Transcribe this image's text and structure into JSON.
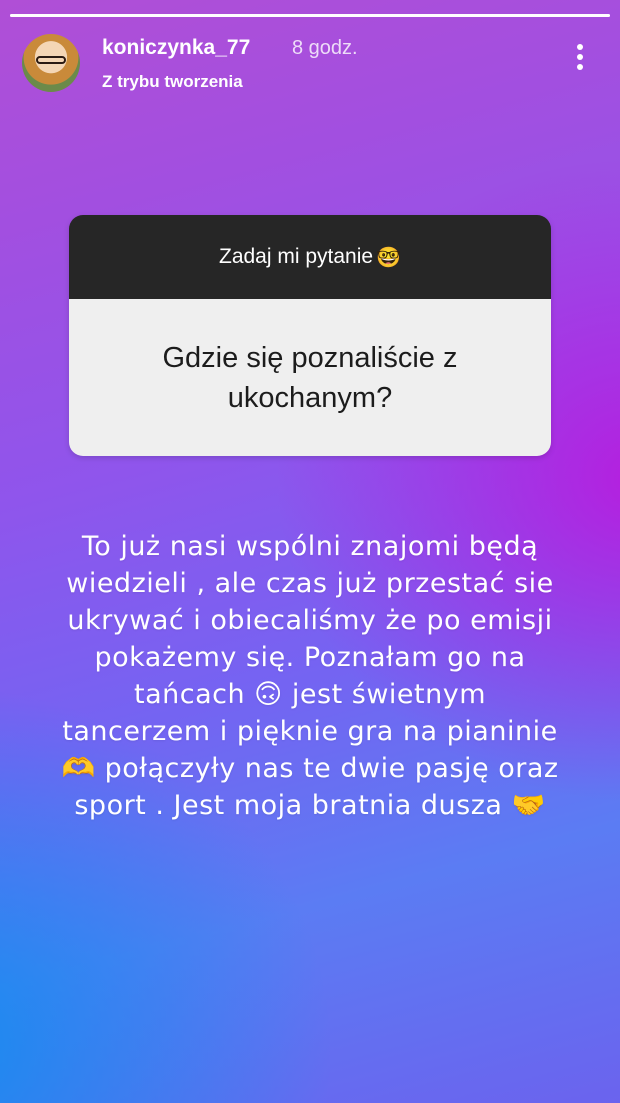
{
  "story": {
    "progress": 1.0
  },
  "header": {
    "username": "koniczynka_77",
    "time_ago": "8 godz.",
    "subtitle": "Z trybu tworzenia",
    "more_icon": "more-vertical-icon"
  },
  "question_sticker": {
    "title": "Zadaj mi pytanie",
    "title_emoji": "🤓",
    "question": "Gdzie się poznaliście z ukochanym?"
  },
  "answer": {
    "lines": [
      "To już nasi wspólni znajomi będą",
      "wiedzieli , ale czas już przestać sie",
      "ukrywać i obiecaliśmy że po emisji",
      "pokażemy się.  Poznałam go na",
      "tańcach 🙃 jest świetnym",
      "tancerzem i pięknie gra na pianinie",
      "🫶 połączyły nas te dwie pasję oraz",
      "sport . Jest moja bratnia dusza 🤝"
    ]
  }
}
